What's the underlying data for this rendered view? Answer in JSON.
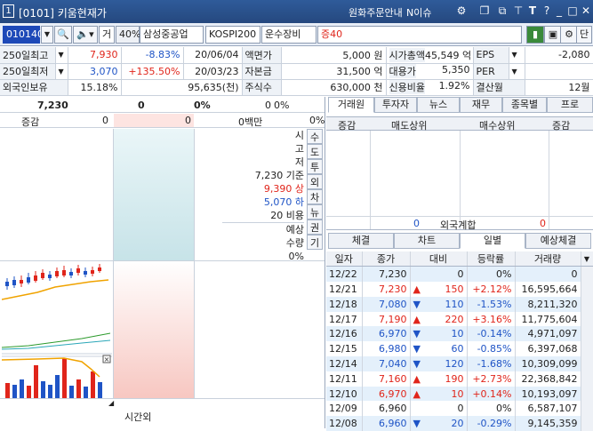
{
  "window": {
    "num": "1",
    "title": "[0101] 키움현재가",
    "order_info": "원화주문안내",
    "issue": "N이슈"
  },
  "toolbar": {
    "code": "010140",
    "gu": "거",
    "pct": "40%",
    "name": "삼성중공업",
    "index": "KOSPI200",
    "sector": "운수장비",
    "margin": "증40",
    "last_btn": "단"
  },
  "info": {
    "rows": [
      {
        "l1": "250일최고",
        "v1": "7,930",
        "p1": "-8.83%",
        "d1": "20/06/04",
        "l2": "액면가",
        "v2": "5,000 원",
        "l3": "시가총액",
        "v3": "45,549 억",
        "l4": "EPS",
        "v4": "-2,080"
      },
      {
        "l1": "250일최저",
        "v1": "3,070",
        "p1": "+135.50%",
        "d1": "20/03/23",
        "l2": "자본금",
        "v2": "31,500 억",
        "l3": "대용가",
        "v3": "5,350",
        "l4": "PER",
        "v4": ""
      },
      {
        "l1": "외국인보유",
        "v1": "15.18%",
        "p1": "",
        "d1": "95,635(천)",
        "l2": "주식수",
        "v2": "630,000 천",
        "l3": "신용비율",
        "v3": "1.92%",
        "l4": "결산월",
        "v4": "12월"
      }
    ]
  },
  "hoga": {
    "price": "7,230",
    "vol": "0",
    "pct": "0%",
    "vol2": "0",
    "pct2": "0%",
    "change_label": "증감",
    "c1": "0",
    "c2": "0",
    "million": "0백만",
    "pct3": "0%",
    "side_labels": [
      "시",
      "고",
      "저"
    ],
    "gijun": "7,230 기준",
    "sang": "9,390 상",
    "ha": "5,070 하",
    "biyong": "20 비용",
    "yesang": "예상",
    "suryang": "수량",
    "zero": "0%",
    "time_label": "시간외",
    "side_tabs": [
      "수",
      "도",
      "투",
      "외",
      "차",
      "뉴",
      "권",
      "기"
    ]
  },
  "right": {
    "tabs": [
      "거래원",
      "투자자",
      "뉴스",
      "재무",
      "종목별",
      "프로"
    ],
    "col_jg": "증감",
    "sell_top": "매도상위",
    "buy_top": "매수상위",
    "col_jg2": "증감",
    "foreign_left": "0",
    "foreign_label": "외국계합",
    "foreign_right": "0",
    "tabs2": [
      "체결",
      "차트",
      "일별",
      "예상체결"
    ],
    "day_headers": [
      "일자",
      "종가",
      "대비",
      "등락률",
      "거래량"
    ],
    "days": [
      {
        "date": "12/22",
        "close": "7,230",
        "arrow": "",
        "diff": "0",
        "rate": "0%",
        "vol": "0",
        "c": "n",
        "hl": true
      },
      {
        "date": "12/21",
        "close": "7,230",
        "arrow": "▲",
        "diff": "150",
        "rate": "+2.12%",
        "vol": "16,595,664",
        "c": "u",
        "hl": false
      },
      {
        "date": "12/18",
        "close": "7,080",
        "arrow": "▼",
        "diff": "110",
        "rate": "-1.53%",
        "vol": "8,211,320",
        "c": "d",
        "hl": true
      },
      {
        "date": "12/17",
        "close": "7,190",
        "arrow": "▲",
        "diff": "220",
        "rate": "+3.16%",
        "vol": "11,775,604",
        "c": "u",
        "hl": false
      },
      {
        "date": "12/16",
        "close": "6,970",
        "arrow": "▼",
        "diff": "10",
        "rate": "-0.14%",
        "vol": "4,971,097",
        "c": "d",
        "hl": true
      },
      {
        "date": "12/15",
        "close": "6,980",
        "arrow": "▼",
        "diff": "60",
        "rate": "-0.85%",
        "vol": "6,397,068",
        "c": "d",
        "hl": false
      },
      {
        "date": "12/14",
        "close": "7,040",
        "arrow": "▼",
        "diff": "120",
        "rate": "-1.68%",
        "vol": "10,309,099",
        "c": "d",
        "hl": true
      },
      {
        "date": "12/11",
        "close": "7,160",
        "arrow": "▲",
        "diff": "190",
        "rate": "+2.73%",
        "vol": "22,368,842",
        "c": "u",
        "hl": false
      },
      {
        "date": "12/10",
        "close": "6,970",
        "arrow": "▲",
        "diff": "10",
        "rate": "+0.14%",
        "vol": "10,193,097",
        "c": "u",
        "hl": true
      },
      {
        "date": "12/09",
        "close": "6,960",
        "arrow": "",
        "diff": "0",
        "rate": "0%",
        "vol": "6,587,107",
        "c": "n",
        "hl": false
      },
      {
        "date": "12/08",
        "close": "6,960",
        "arrow": "▼",
        "diff": "20",
        "rate": "-0.29%",
        "vol": "9,145,359",
        "c": "d",
        "hl": true
      }
    ]
  }
}
